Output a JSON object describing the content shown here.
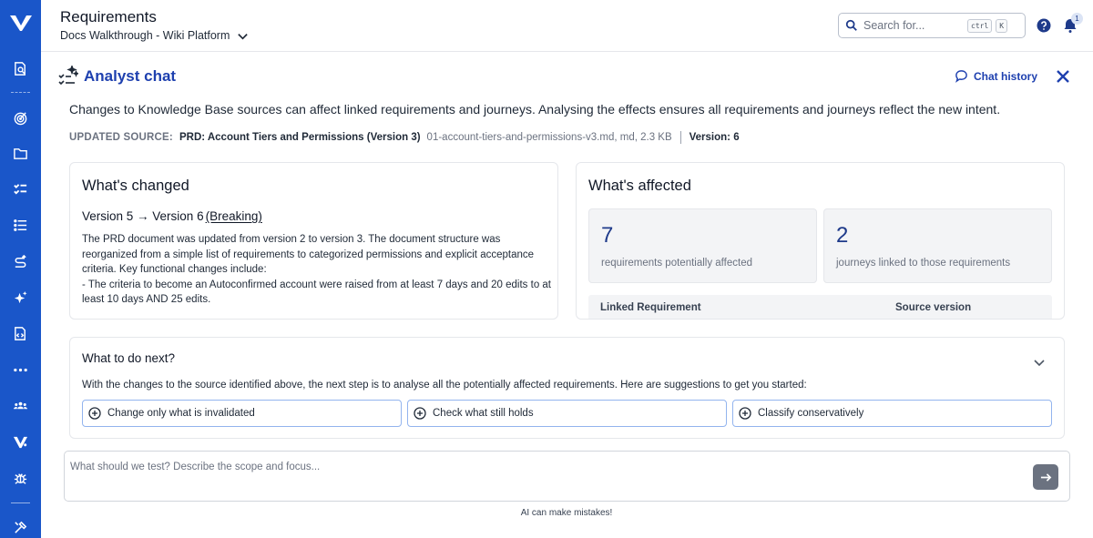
{
  "header": {
    "title": "Requirements",
    "project": "Docs Walkthrough - Wiki Platform",
    "search_placeholder": "Search for...",
    "shortcut_keys": [
      "ctrl",
      "K"
    ],
    "notification_count": "1"
  },
  "sidebar": {
    "items": [
      {
        "icon": "document-search-icon"
      },
      {
        "icon": "target-icon"
      },
      {
        "icon": "folder-icon"
      },
      {
        "icon": "checklist-icon"
      },
      {
        "icon": "list-icon"
      },
      {
        "icon": "route-icon"
      },
      {
        "icon": "sparkle-icon"
      },
      {
        "icon": "code-file-icon"
      },
      {
        "icon": "more-icon"
      },
      {
        "icon": "users-icon"
      },
      {
        "icon": "brand-icon"
      },
      {
        "icon": "bug-icon"
      },
      {
        "icon": "tools-icon"
      }
    ]
  },
  "chat": {
    "title": "Analyst chat",
    "history_label": "Chat history",
    "intro": "Changes to Knowledge Base sources can affect linked requirements and journeys. Analysing the effects ensures all requirements and journeys reflect the new intent.",
    "source": {
      "label": "UPDATED SOURCE:",
      "name": "PRD: Account Tiers and Permissions (Version 3)",
      "meta": "01-account-tiers-and-permissions-v3.md, md, 2.3 KB",
      "version": "Version: 6"
    }
  },
  "changed": {
    "title": "What's changed",
    "version_change": "Version 5 → Version 6",
    "breaking": "(Breaking)",
    "text": "The PRD document was updated from version 2 to version 3. The document structure was reorganized from a simple list of requirements to categorized permissions and explicit acceptance criteria. Key functional changes include:\n- The criteria to become an Autoconfirmed account were raised from at least 7 days and 20 edits to at least 10 days AND 25 edits."
  },
  "affected": {
    "title": "What's affected",
    "requirements_count": "7",
    "requirements_label": "requirements potentially affected",
    "journeys_count": "2",
    "journeys_label": "journeys linked to those requirements",
    "table_headers": [
      "Linked Requirement",
      "Source version"
    ]
  },
  "next": {
    "title": "What to do next?",
    "description": "With the changes to the source identified above, the next step is to analyse all the potentially affected requirements. Here are suggestions to get you started:",
    "suggestions": [
      "Change only what is invalidated",
      "Check what still holds",
      "Classify conservatively"
    ]
  },
  "composer": {
    "placeholder": "What should we test? Describe the scope and focus...",
    "disclaimer": "AI can make mistakes!"
  },
  "colors": {
    "sidebar": "#1a56c9",
    "accent": "#1e40af",
    "send_button": "#6b7280"
  }
}
